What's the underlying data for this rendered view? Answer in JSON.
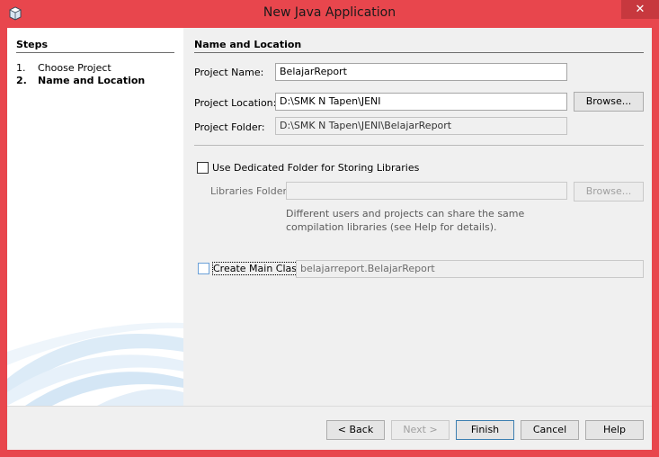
{
  "window": {
    "title": "New Java Application",
    "close_glyph": "✕"
  },
  "steps": {
    "title": "Steps",
    "items": [
      {
        "num": "1.",
        "label": "Choose Project"
      },
      {
        "num": "2.",
        "label": "Name and Location"
      }
    ]
  },
  "section": {
    "title": "Name and Location"
  },
  "form": {
    "project_name_label": "Project Name:",
    "project_name_value": "BelajarReport",
    "project_location_label": "Project Location:",
    "project_location_value": "D:\\SMK N Tapen\\JENI",
    "browse_label": "Browse...",
    "project_folder_label": "Project Folder:",
    "project_folder_value": "D:\\SMK N Tapen\\JENI\\BelajarReport",
    "dedicated_folder_label": "Use Dedicated Folder for Storing Libraries",
    "libraries_folder_label": "Libraries Folder:",
    "libraries_folder_value": "",
    "libraries_browse_label": "Browse...",
    "help_text": "Different users and projects can share the same compilation libraries (see Help for details).",
    "create_main_class_label": "Create Main Class",
    "main_class_value": "belajarreport.BelajarReport"
  },
  "buttons": {
    "back": "< Back",
    "next": "Next >",
    "finish": "Finish",
    "cancel": "Cancel",
    "help": "Help"
  },
  "colors": {
    "window_frame": "#e8464d",
    "accent": "#3c7fb1"
  }
}
